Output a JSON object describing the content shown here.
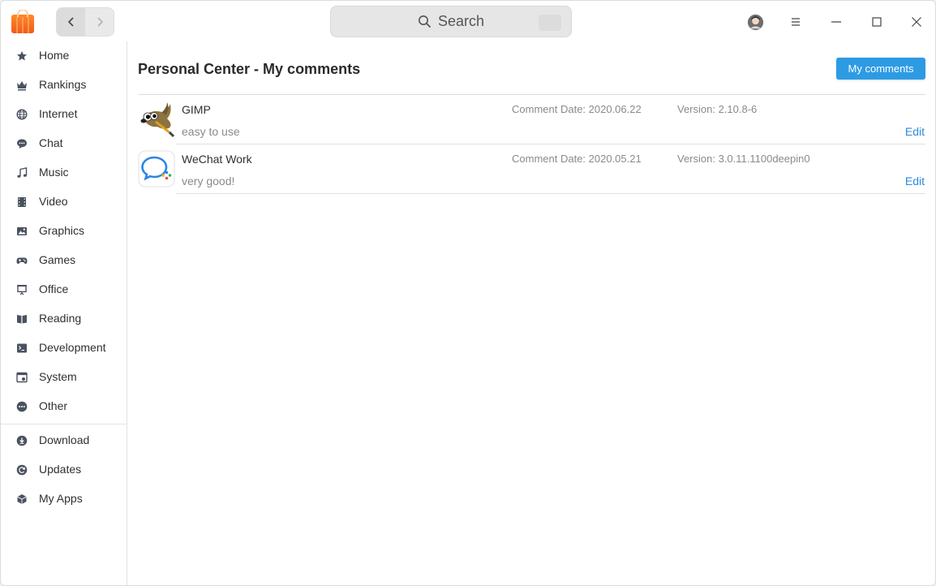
{
  "search": {
    "placeholder": "Search"
  },
  "sidebar": {
    "categories": [
      {
        "label": "Home",
        "icon": "star-icon"
      },
      {
        "label": "Rankings",
        "icon": "crown-icon"
      },
      {
        "label": "Internet",
        "icon": "globe-icon"
      },
      {
        "label": "Chat",
        "icon": "chat-bubble-icon"
      },
      {
        "label": "Music",
        "icon": "music-note-icon"
      },
      {
        "label": "Video",
        "icon": "film-icon"
      },
      {
        "label": "Graphics",
        "icon": "image-icon"
      },
      {
        "label": "Games",
        "icon": "gamepad-icon"
      },
      {
        "label": "Office",
        "icon": "presentation-icon"
      },
      {
        "label": "Reading",
        "icon": "book-icon"
      },
      {
        "label": "Development",
        "icon": "terminal-icon"
      },
      {
        "label": "System",
        "icon": "system-window-icon"
      },
      {
        "label": "Other",
        "icon": "more-dots-icon"
      }
    ],
    "personal": [
      {
        "label": "Download",
        "icon": "download-icon"
      },
      {
        "label": "Updates",
        "icon": "refresh-icon"
      },
      {
        "label": "My Apps",
        "icon": "cube-icon"
      }
    ]
  },
  "main": {
    "title": "Personal Center - My comments",
    "my_comments_button": "My comments",
    "comments": [
      {
        "app_name": "GIMP",
        "comment": "easy to use",
        "date": "Comment Date: 2020.06.22",
        "version": "Version: 2.10.8-6",
        "edit_label": "Edit"
      },
      {
        "app_name": "WeChat Work",
        "comment": "very good!",
        "date": "Comment Date: 2020.05.21",
        "version": "Version: 3.0.11.1100deepin0",
        "edit_label": "Edit"
      }
    ]
  },
  "colors": {
    "accent": "#2d9be4",
    "link": "#2d8ae0",
    "sidebar_icon": "#4a5260"
  }
}
